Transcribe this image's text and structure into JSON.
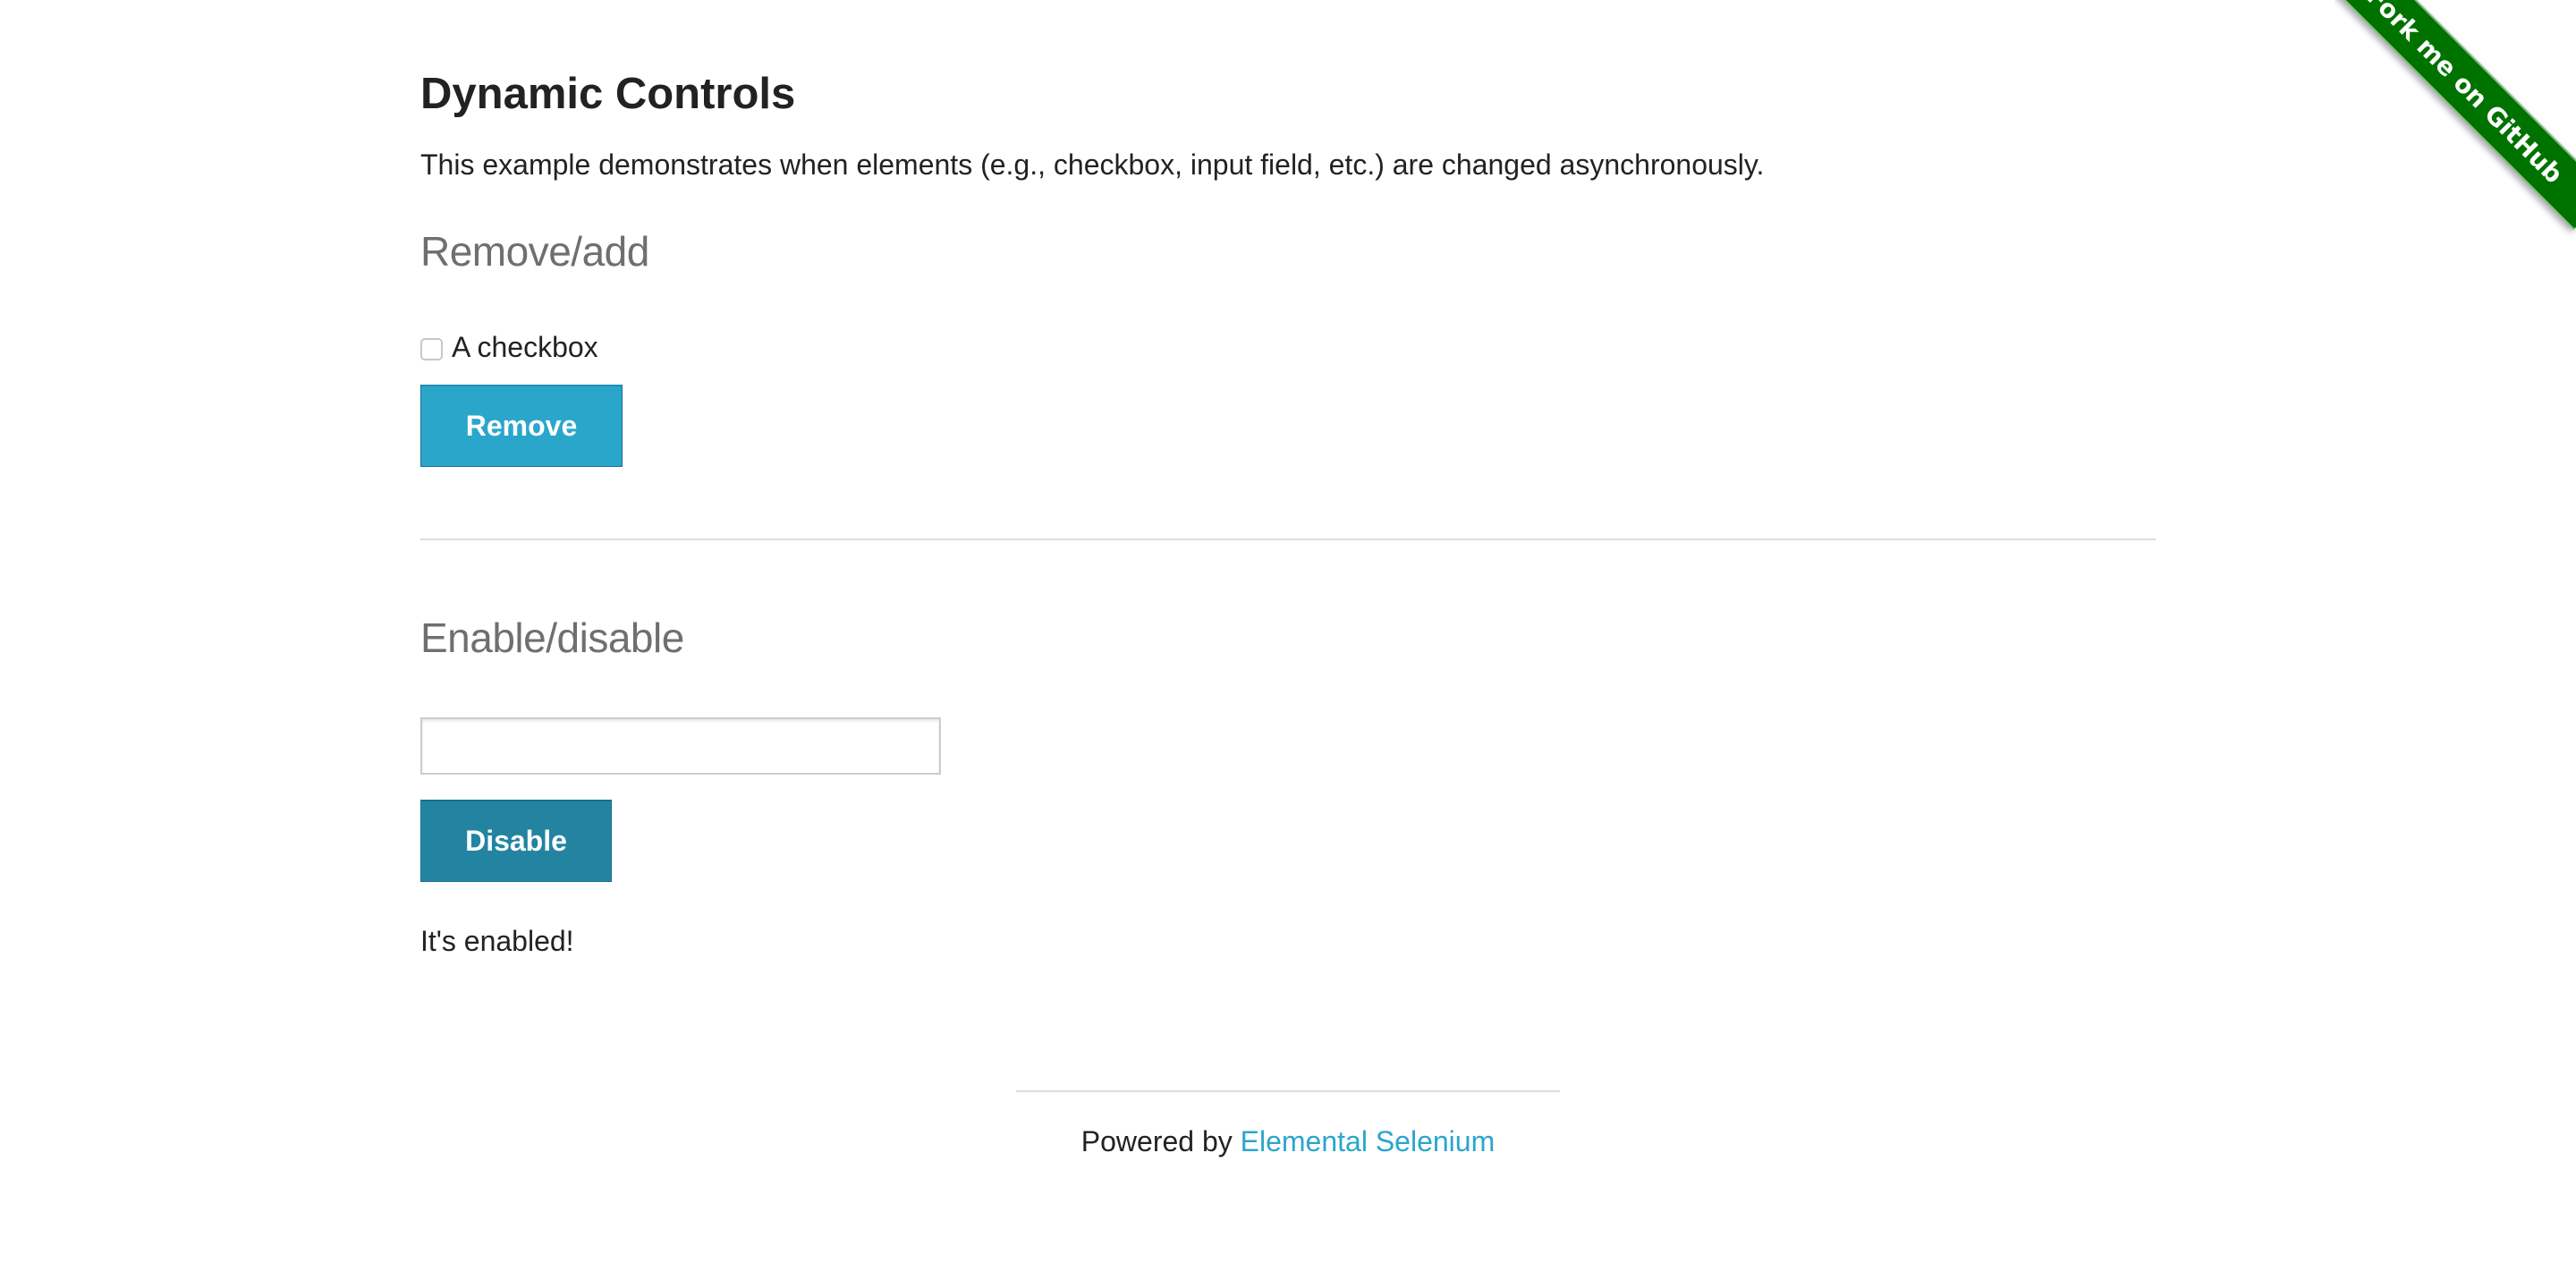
{
  "page": {
    "title": "Dynamic Controls",
    "intro": "This example demonstrates when elements (e.g., checkbox, input field, etc.) are changed asynchronously."
  },
  "remove_add": {
    "heading": "Remove/add",
    "checkbox_label": "A checkbox",
    "checkbox_checked": false,
    "button_label": "Remove"
  },
  "enable_disable": {
    "heading": "Enable/disable",
    "input_value": "",
    "button_label": "Disable",
    "status_message": "It's enabled!"
  },
  "footer": {
    "prefix": "Powered by ",
    "link_text": "Elemental Selenium"
  },
  "ribbon": {
    "text": "Fork me on GitHub"
  },
  "colors": {
    "button_remove": "#2ba6cb",
    "button_disable": "#2284a1",
    "link": "#2ba6cb",
    "ribbon": "#007200",
    "section_heading": "#6f6f6f"
  }
}
